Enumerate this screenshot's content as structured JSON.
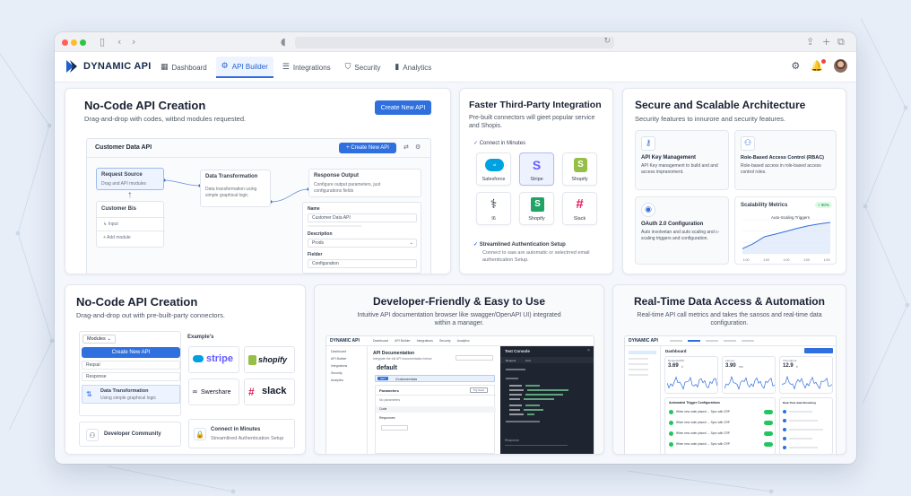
{
  "app": {
    "logo_text": "DYNAMIC API",
    "tabs": [
      {
        "label": "Dashboard",
        "icon": "grid-icon"
      },
      {
        "label": "API Builder",
        "icon": "gear-icon"
      },
      {
        "label": "Integrations",
        "icon": "sliders-icon"
      },
      {
        "label": "Security",
        "icon": "shield-icon"
      },
      {
        "label": "Analytics",
        "icon": "bar-chart-icon"
      }
    ],
    "active_tab": "API Builder",
    "accent": "#2f6fde"
  },
  "card_nocode_top": {
    "title": "No-Code API Creation",
    "subtitle": "Drag-and-drop with codes, witbnd modules requested.",
    "create_button": "Create New API",
    "builder": {
      "title": "Customer Data API",
      "create_button": "+ Create New API",
      "request_source": {
        "title": "Request Source",
        "desc": "Drag and API modules"
      },
      "data_transformation": {
        "title": "Data Transformation",
        "desc": "Data transformation using simple graphical logic"
      },
      "response_output": {
        "title": "Response Output",
        "desc": "Configure output parameters, just configurations fields"
      },
      "customer_bis": {
        "title": "Customer Bis",
        "items": [
          "Input",
          "+ Add module"
        ]
      },
      "form": {
        "name_label": "Name",
        "name_value": "Customer Data API",
        "desc_label": "Description",
        "desc_value": "Prods",
        "fields_label": "Fielder",
        "fields_value": "Configuration"
      }
    }
  },
  "card_third_party": {
    "title": "Faster Third-Party Integration",
    "subtitle": "Pre-built connectors will gieet popular service and Shopis.",
    "connect_heading": "Connect in Minutes",
    "connectors": [
      {
        "label": "Salesforce",
        "mark": "salesforce",
        "color": "#00a1e0"
      },
      {
        "label": "Stripe",
        "mark": "S",
        "color": "#635bff"
      },
      {
        "label": "Shopify",
        "mark": "S",
        "color": "#95bf47"
      },
      {
        "label": "I6",
        "mark": "I6",
        "color": "#1f2937"
      },
      {
        "label": "Shopify",
        "mark": "S",
        "color": "#21a366"
      },
      {
        "label": "Slack",
        "mark": "#",
        "color": "#e01e5a"
      }
    ],
    "auth_heading": "Streamlined Authentication Setup",
    "auth_desc": "Connect to saw are automatic or selectrred email authentication Setup."
  },
  "card_secure": {
    "title": "Secure and Scalable Architecture",
    "subtitle": "Security features to innurore and security features.",
    "features": [
      {
        "title": "API Key Management",
        "desc": "API Key management to build and and access impranoment.",
        "icon": "key-icon"
      },
      {
        "title": "Role-Based Access Control (RBAC)",
        "desc": "Role-based access in role-based access control roles.",
        "icon": "users-icon"
      },
      {
        "title": "OAuth 2.0 Configuration",
        "desc": "Auto involvetan and auto scaling and c-scaling triggers and configuration.",
        "icon": "oauth-icon"
      }
    ],
    "metrics": {
      "title": "Scalability Metrics",
      "badge": "+ 90%",
      "annotation": "Auto-Scaling Triggers",
      "line": [
        0.15,
        0.3,
        0.5,
        0.58,
        0.66,
        0.75,
        0.82,
        0.88,
        0.92
      ],
      "x_ticks": [
        "1:00",
        "1:00",
        "1:00",
        "1:00",
        "1:00"
      ]
    }
  },
  "card_nocode_bottom": {
    "title": "No-Code API Creation",
    "subtitle": "Drag-and-drop out with pre-built-party connectors.",
    "modules_label": "Modules ⌄",
    "create_button": "Create New API",
    "rows": [
      "Reqsal",
      "Response"
    ],
    "transformation": {
      "title": "Data Transformation",
      "desc": "Using simple graphical logic"
    },
    "examples_label": "Example's",
    "brands": [
      {
        "name": "stripe",
        "color": "#635bff"
      },
      {
        "name": "shopify",
        "color": "#111827"
      },
      {
        "name": "Swershare",
        "color": "#111827"
      },
      {
        "name": "slack",
        "color": "#111827"
      }
    ],
    "community": "Developer Community",
    "connect": {
      "title": "Connect in Minutes",
      "desc": "Streamlined Authentication Setup"
    }
  },
  "card_dev": {
    "title": "Developer-Friendly & Easy to Use",
    "subtitle": "Intuitive API documentation browser like swagger/OpenAPI UI) integrated within a manager.",
    "shot": {
      "logo": "DYNAMIC API",
      "tabs": [
        "Dashboard",
        "API Builder",
        "Integrations",
        "Security",
        "Analytics"
      ],
      "sidebar": [
        "Dashboard",
        "API Builder",
        "Integrations",
        "Security",
        "Analytics"
      ],
      "doc_title": "API Documentation",
      "doc_sub": "Integrate the full API documentation below",
      "default_label": "default",
      "get_label": "GET",
      "endpoint": "/Customer/data",
      "params_label": "Parameters",
      "try_label": "Try it out",
      "no_params": "No parameters",
      "codes_label": "Code",
      "responses_label": "Responses",
      "console_title": "Test Console",
      "console_tabs": [
        "Request",
        "Curl"
      ],
      "response_label": "Response"
    }
  },
  "card_realtime": {
    "title": "Real-Time Data Access & Automation",
    "subtitle": "Real-time API call metrics and takes the sansos and real-time data configuration.",
    "shot": {
      "logo": "DYNAMIC API",
      "dashboard_label": "Dashboard",
      "stats": [
        {
          "label": "Requests/Min",
          "value": "3.69",
          "unit": "k"
        },
        {
          "label": "Latency",
          "value": "3.90",
          "unit": "ms"
        },
        {
          "label": "Throughput",
          "value": "12.9",
          "unit": "k"
        }
      ],
      "automation_title": "Automated Trigger Configurations",
      "streaming_title": "Real-Time data Streaming",
      "rules": [
        "When new order placed → Sync with CRP",
        "When new order placed → Sync with CRP",
        "When new order placed → Sync with CRP",
        "When new order placed → Sync with CRP"
      ]
    }
  }
}
